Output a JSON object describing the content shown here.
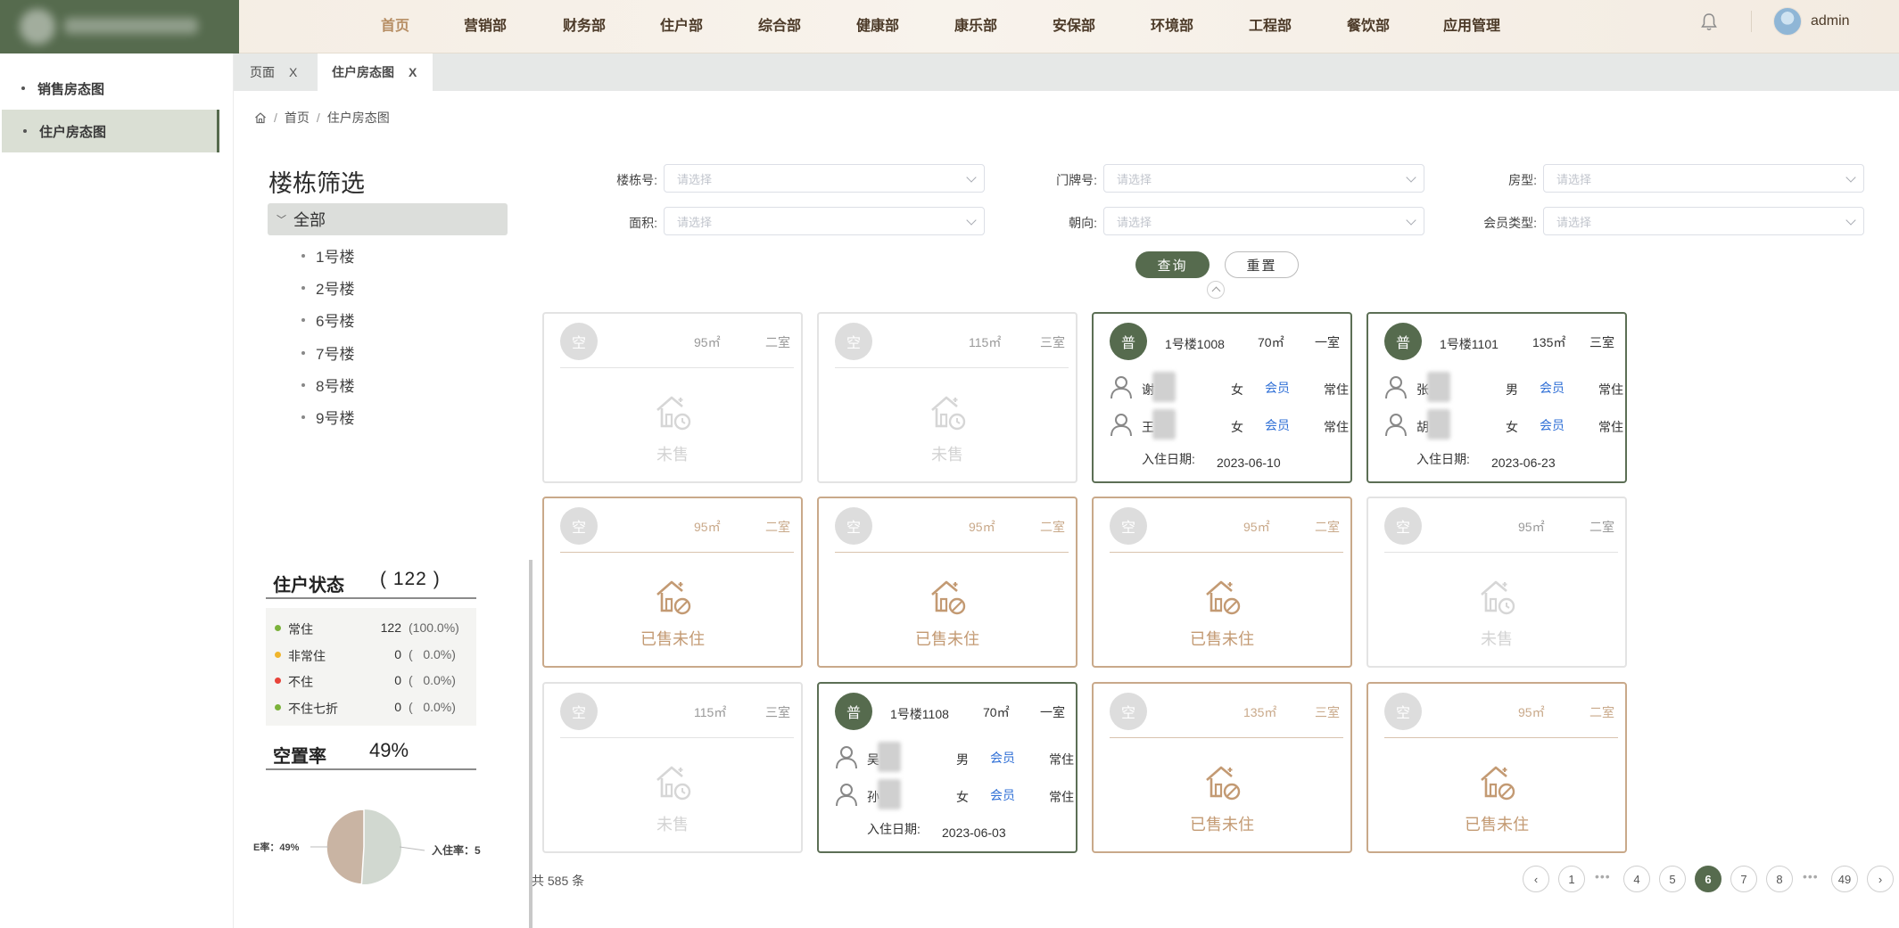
{
  "topnav": {
    "items": [
      "首页",
      "营销部",
      "财务部",
      "住户部",
      "综合部",
      "健康部",
      "康乐部",
      "安保部",
      "环境部",
      "工程部",
      "餐饮部",
      "应用管理"
    ],
    "active_index": 0,
    "user": "admin"
  },
  "sidebar": {
    "items": [
      {
        "label": "销售房态图",
        "active": false
      },
      {
        "label": "住户房态图",
        "active": true
      }
    ]
  },
  "tabs": [
    {
      "label": "页面",
      "close": "X",
      "active": false
    },
    {
      "label": "住户房态图",
      "close": "X",
      "active": true
    }
  ],
  "breadcrumb": {
    "home": "首页",
    "current": "住户房态图"
  },
  "building_filter": {
    "title": "楼栋筛选",
    "all_label": "全部",
    "buildings": [
      "1号楼",
      "2号楼",
      "6号楼",
      "7号楼",
      "8号楼",
      "9号楼"
    ]
  },
  "filters": {
    "building_no": {
      "label": "楼栋号:",
      "placeholder": "请选择"
    },
    "door_no": {
      "label": "门牌号:",
      "placeholder": "请选择"
    },
    "room_type": {
      "label": "房型:",
      "placeholder": "请选择"
    },
    "area": {
      "label": "面积:",
      "placeholder": "请选择"
    },
    "orientation": {
      "label": "朝向:",
      "placeholder": "请选择"
    },
    "member_type": {
      "label": "会员类型:",
      "placeholder": "请选择"
    },
    "query_label": "查询",
    "reset_label": "重置"
  },
  "status": {
    "title": "住户状态",
    "count_text": "( 122 )",
    "rows": [
      {
        "label": "常住",
        "count": "122",
        "pct": "(100.0%)",
        "color": "#7bb23a"
      },
      {
        "label": "非常住",
        "count": "0",
        "pct": "(   0.0%)",
        "color": "#f0b52c"
      },
      {
        "label": "不住",
        "count": "0",
        "pct": "(   0.0%)",
        "color": "#e8433a"
      },
      {
        "label": "不住七折",
        "count": "0",
        "pct": "(   0.0%)",
        "color": "#7bb23a"
      }
    ],
    "vacancy_label": "空置率",
    "vacancy_value": "49%",
    "pie": {
      "left_label": "E率：49%",
      "right_label": "入住率：5",
      "vacancy_fraction": 0.49,
      "vacancy_color": "#c9b4a3",
      "occupied_color": "#d1d8d0"
    }
  },
  "cards": [
    {
      "kind": "unsold",
      "badge": "空",
      "area": "95㎡",
      "type": "二室",
      "label": "未售"
    },
    {
      "kind": "unsold",
      "badge": "空",
      "area": "115㎡",
      "type": "三室",
      "label": "未售"
    },
    {
      "kind": "occupied",
      "badge": "普",
      "name": "1号楼1008",
      "area": "70㎡",
      "type": "一室",
      "residents": [
        {
          "name": "谢",
          "gender": "女",
          "member": "会员",
          "stay": "常住"
        },
        {
          "name": "王",
          "gender": "女",
          "member": "会员",
          "stay": "常住"
        }
      ],
      "checkin_label": "入住日期:",
      "checkin": "2023-06-10"
    },
    {
      "kind": "occupied",
      "badge": "普",
      "name": "1号楼1101",
      "area": "135㎡",
      "type": "三室",
      "residents": [
        {
          "name": "张",
          "gender": "男",
          "member": "会员",
          "stay": "常住"
        },
        {
          "name": "胡",
          "gender": "女",
          "member": "会员",
          "stay": "常住"
        }
      ],
      "checkin_label": "入住日期:",
      "checkin": "2023-06-23"
    },
    {
      "kind": "vacantsold",
      "badge": "空",
      "area": "95㎡",
      "type": "二室",
      "label": "已售未住"
    },
    {
      "kind": "vacantsold",
      "badge": "空",
      "area": "95㎡",
      "type": "二室",
      "label": "已售未住"
    },
    {
      "kind": "vacantsold",
      "badge": "空",
      "area": "95㎡",
      "type": "二室",
      "label": "已售未住"
    },
    {
      "kind": "unsold",
      "badge": "空",
      "area": "95㎡",
      "type": "二室",
      "label": "未售"
    },
    {
      "kind": "unsold",
      "badge": "空",
      "area": "115㎡",
      "type": "三室",
      "label": "未售"
    },
    {
      "kind": "occupied",
      "badge": "普",
      "name": "1号楼1108",
      "area": "70㎡",
      "type": "一室",
      "residents": [
        {
          "name": "吴",
          "gender": "男",
          "member": "会员",
          "stay": "常住"
        },
        {
          "name": "孙",
          "gender": "女",
          "member": "会员",
          "stay": "常住"
        }
      ],
      "checkin_label": "入住日期:",
      "checkin": "2023-06-03"
    },
    {
      "kind": "vacantsold",
      "badge": "空",
      "area": "135㎡",
      "type": "三室",
      "label": "已售未住"
    },
    {
      "kind": "vacantsold",
      "badge": "空",
      "area": "95㎡",
      "type": "二室",
      "label": "已售未住"
    }
  ],
  "pagination": {
    "total_text": "共 585 条",
    "prev": "‹",
    "next": "›",
    "pages": [
      "1",
      "4",
      "5",
      "6",
      "7",
      "8",
      "49"
    ],
    "ellipsis": "•••",
    "current": "6"
  },
  "colors": {
    "accent": "#566b4e",
    "sold_vacant": "#c39a73",
    "member_link": "#2f6fd6"
  }
}
